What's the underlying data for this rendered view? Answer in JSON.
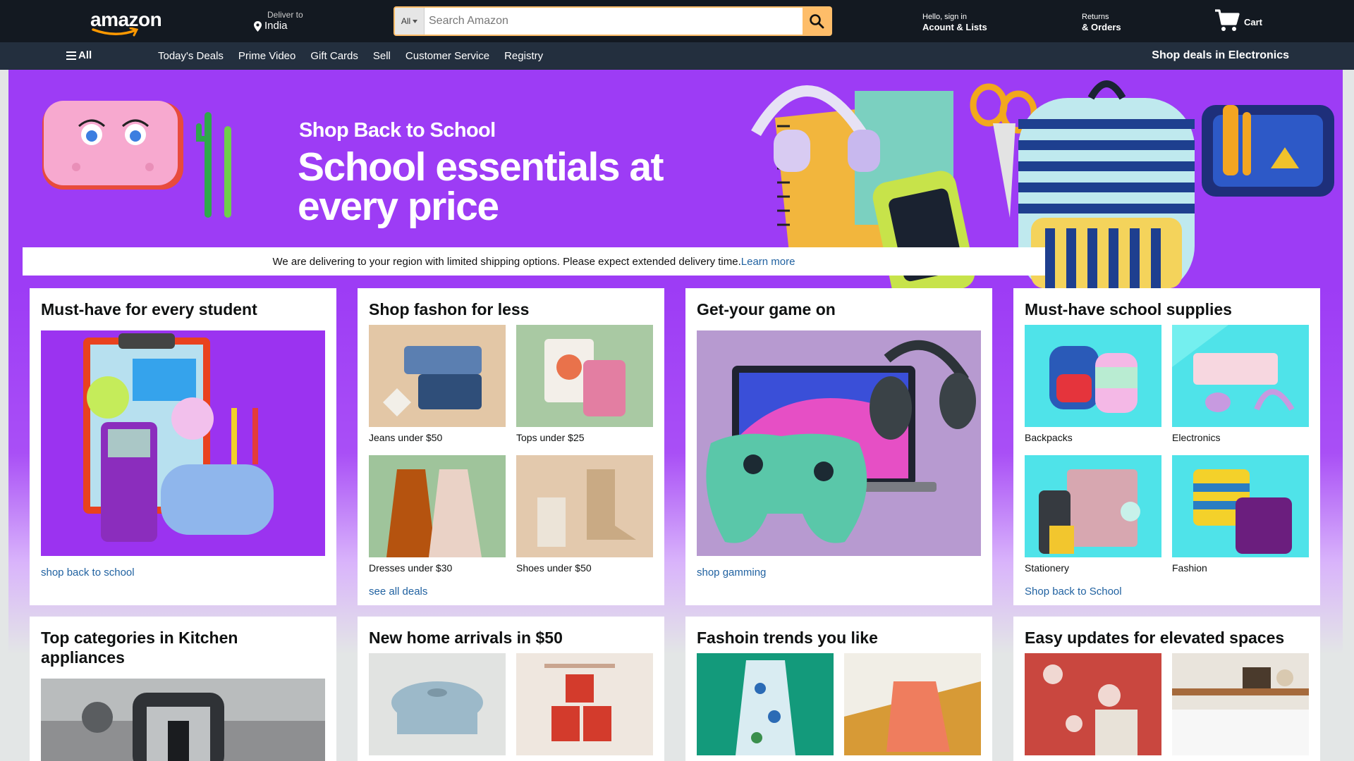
{
  "header": {
    "logo": "amazon",
    "deliver_small": "Deliver to",
    "deliver_location": "India",
    "search_category": "All",
    "search_placeholder": "Search Amazon",
    "account_small": "Hello, sign in",
    "account_big": "Acount & Lists",
    "returns_small": "Returns",
    "returns_big": "& Orders",
    "cart_label": "Cart"
  },
  "subnav": {
    "all_label": "All",
    "links": [
      "Today's Deals",
      "Prime Video",
      "Gift Cards",
      "Sell",
      "Customer Service",
      "Registry"
    ],
    "promo": "Shop deals in Electronics"
  },
  "hero": {
    "subtitle": "Shop Back to School",
    "title": "School essentials at every price"
  },
  "notice": {
    "text": "We are delivering to your region with limited shipping options. Please expect extended delivery time.",
    "link": "Learn more"
  },
  "cards": [
    {
      "title": "Must-have for every student",
      "link": "shop back to school"
    },
    {
      "title": "Shop fashon for less",
      "items": [
        "Jeans under $50",
        "Tops under $25",
        "Dresses under $30",
        "Shoes under $50"
      ],
      "link": "see all deals"
    },
    {
      "title": "Get-your game on",
      "link": "shop gamming"
    },
    {
      "title": "Must-have school supplies",
      "items": [
        "Backpacks",
        "Electronics",
        "Stationery",
        "Fashion"
      ],
      "link": "Shop back to School"
    },
    {
      "title": "Top categories in Kitchen appliances"
    },
    {
      "title": "New home arrivals in $50"
    },
    {
      "title": "Fashoin trends you like"
    },
    {
      "title": "Easy updates for elevated spaces"
    }
  ],
  "colors": {
    "nav_bg": "#131921",
    "subnav_bg": "#232f3e",
    "hero_bg": "#9d3cf5",
    "search_button": "#febd69",
    "link": "#2162a1"
  }
}
